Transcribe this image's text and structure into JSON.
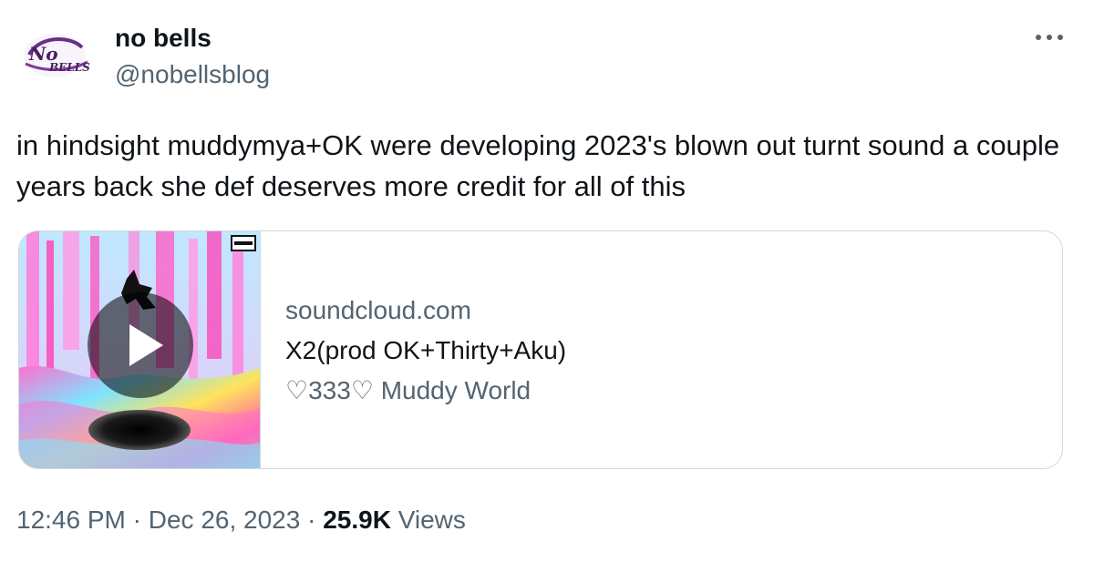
{
  "tweet": {
    "author": {
      "display_name": "no bells",
      "handle": "@nobellsblog",
      "avatar_text": "NoBELLS"
    },
    "text": "in hindsight muddymya+OK were developing 2023's blown out turnt sound a couple years back she def deserves more credit for all of this",
    "card": {
      "domain": "soundcloud.com",
      "title": "X2(prod OK+Thirty+Aku)",
      "description": "♡333♡ Muddy World",
      "media_badge_text": "PARENTAL ADVISORY EXPLICIT CONTENT",
      "icons": {
        "play": "play-icon"
      }
    },
    "meta": {
      "time": "12:46 PM",
      "separator": " · ",
      "date": "Dec 26, 2023",
      "views_count": "25.9K",
      "views_label": "Views"
    },
    "icons": {
      "more": "more-horizontal-icon"
    },
    "colors": {
      "text_primary": "#0f1419",
      "text_secondary": "#536471",
      "border": "#cfd9de",
      "avatar_purple": "#5b2a73"
    }
  }
}
